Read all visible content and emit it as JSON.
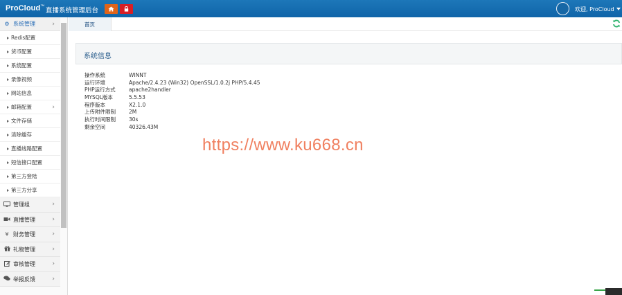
{
  "header": {
    "brand": "ProCloud",
    "brand_mark": "™",
    "app_title": "直播系统管理后台",
    "home_icon": "home-icon",
    "lock_icon": "lock-icon",
    "user_greeting": "欢迎, ProCloud",
    "colors": {
      "bar": "#1a70b3",
      "home_button": "#e0641a",
      "lock_button": "#d81f26"
    }
  },
  "sidebar": {
    "groups": [
      {
        "label": "系统管理",
        "icon": "gears-icon",
        "active": true,
        "items": [
          {
            "label": "Redis配置"
          },
          {
            "label": "货币配置"
          },
          {
            "label": "系统配置"
          },
          {
            "label": "录像视频"
          },
          {
            "label": "网站信息"
          },
          {
            "label": "邮箱配置",
            "expandable": true
          },
          {
            "label": "文件存储"
          },
          {
            "label": "清除缓存"
          },
          {
            "label": "直播线路配置"
          },
          {
            "label": "短信接口配置"
          },
          {
            "label": "第三方登陆"
          },
          {
            "label": "第三方分享"
          }
        ]
      },
      {
        "label": "管理组",
        "icon": "desktop-icon"
      },
      {
        "label": "直播管理",
        "icon": "video-camera-icon"
      },
      {
        "label": "财务管理",
        "icon": "yen-icon"
      },
      {
        "label": "礼物管理",
        "icon": "gift-icon"
      },
      {
        "label": "审核管理",
        "icon": "edit-icon"
      },
      {
        "label": "举报反馈",
        "icon": "comments-icon"
      }
    ]
  },
  "tabs": [
    {
      "label": "首页"
    }
  ],
  "main": {
    "panel_title": "系统信息",
    "info": [
      {
        "key": "操作系统",
        "value": "WINNT"
      },
      {
        "key": "运行环境",
        "value": "Apache/2.4.23 (Win32) OpenSSL/1.0.2j PHP/5.4.45"
      },
      {
        "key": "PHP运行方式",
        "value": "apache2handler"
      },
      {
        "key": "MYSQL版本",
        "value": "5.5.53"
      },
      {
        "key": "程序版本",
        "value": "X2.1.0"
      },
      {
        "key": "上传附件限制",
        "value": "2M"
      },
      {
        "key": "执行时间限制",
        "value": "30s"
      },
      {
        "key": "剩余空间",
        "value": "40326.43M"
      }
    ]
  },
  "watermark": "https://www.ku668.cn"
}
